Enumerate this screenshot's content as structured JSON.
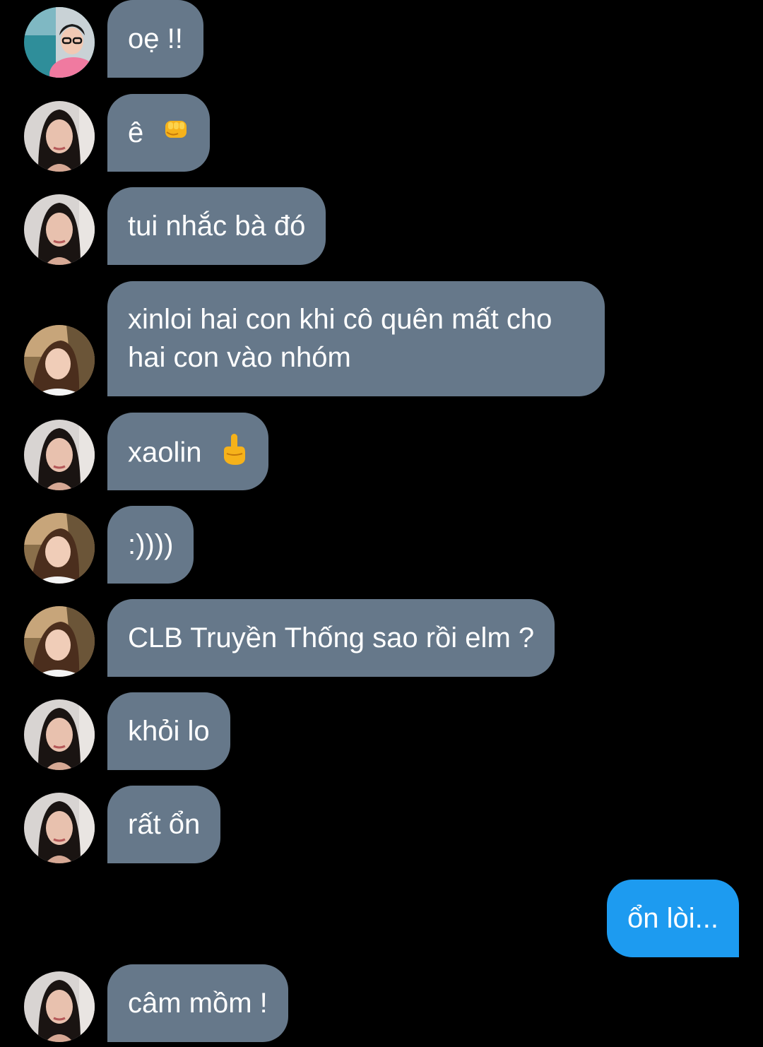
{
  "conversation": {
    "messages": [
      {
        "sender": "avatar-a",
        "text": "oẹ !!"
      },
      {
        "sender": "avatar-b",
        "text": "ê",
        "emoji": "raised-fist-emoji"
      },
      {
        "sender": "avatar-b",
        "text": "tui nhắc bà đó"
      },
      {
        "sender": "avatar-c",
        "text": "xinloi hai con khi cô quên mất cho hai con vào nhóm"
      },
      {
        "sender": "avatar-b",
        "text": "xaolin",
        "emoji": "middle-finger-emoji"
      },
      {
        "sender": "avatar-c",
        "text": ":))))"
      },
      {
        "sender": "avatar-c",
        "text": "CLB Truyền Thống sao rồi elm ?"
      },
      {
        "sender": "avatar-b",
        "text": "khỏi lo"
      },
      {
        "sender": "avatar-b",
        "text": "rất ổn"
      },
      {
        "sender": "me",
        "text": "ổn lòi..."
      },
      {
        "sender": "avatar-b",
        "text": "câm mồm !"
      }
    ]
  },
  "colors": {
    "background": "#000000",
    "incoming_bubble": "#66788a",
    "outgoing_bubble": "#1d9bf0",
    "text": "#ffffff"
  }
}
